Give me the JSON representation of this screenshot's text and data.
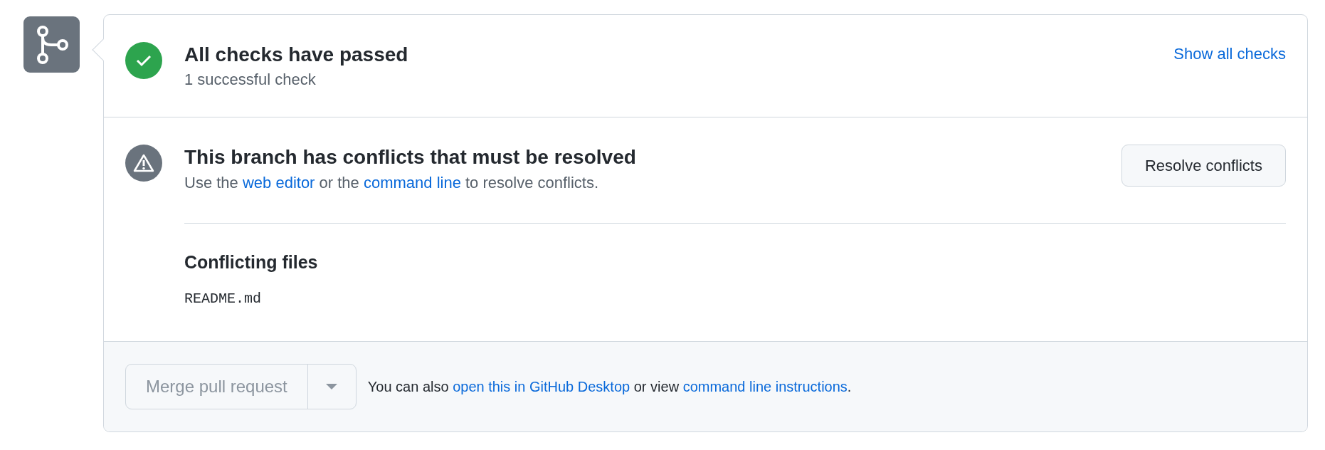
{
  "checks": {
    "title": "All checks have passed",
    "subtitle": "1 successful check",
    "link": "Show all checks"
  },
  "conflicts": {
    "title": "This branch has conflicts that must be resolved",
    "message": [
      {
        "kind": "text",
        "text": "Use the "
      },
      {
        "kind": "link",
        "text": "web editor"
      },
      {
        "kind": "text",
        "text": " or the "
      },
      {
        "kind": "link",
        "text": "command line"
      },
      {
        "kind": "text",
        "text": " to resolve conflicts."
      }
    ],
    "button": "Resolve conflicts",
    "files_heading": "Conflicting files",
    "files": [
      "README.md"
    ]
  },
  "merge": {
    "button": "Merge pull request",
    "disabled": true,
    "message": [
      {
        "kind": "text",
        "text": "You can also "
      },
      {
        "kind": "link",
        "text": "open this in GitHub Desktop"
      },
      {
        "kind": "text",
        "text": " or view "
      },
      {
        "kind": "link",
        "text": "command line instructions"
      },
      {
        "kind": "text",
        "text": "."
      }
    ]
  }
}
